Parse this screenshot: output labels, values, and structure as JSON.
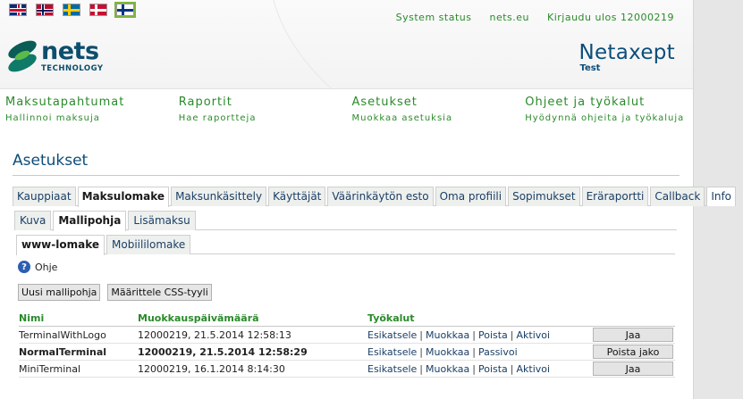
{
  "flags": [
    {
      "name": "uk-flag-icon",
      "cls": "flag-uk"
    },
    {
      "name": "norway-flag-icon",
      "cls": "flag-no"
    },
    {
      "name": "sweden-flag-icon",
      "cls": "flag-se"
    },
    {
      "name": "denmark-flag-icon",
      "cls": "flag-dk"
    },
    {
      "name": "finland-flag-icon",
      "cls": "flag-fi"
    }
  ],
  "top_links": {
    "system_status": "System status",
    "site": "nets.eu",
    "logout": "Kirjaudu ulos 12000219"
  },
  "logo": {
    "word": "nets",
    "sub": "TECHNOLOGY"
  },
  "product": {
    "name": "Netaxept",
    "env": "Test"
  },
  "main_nav": [
    {
      "title": "Maksutapahtumat",
      "sub": "Hallinnoi maksuja"
    },
    {
      "title": "Raportit",
      "sub": "Hae raportteja"
    },
    {
      "title": "Asetukset",
      "sub": "Muokkaa asetuksia"
    },
    {
      "title": "Ohjeet ja työkalut",
      "sub": "Hyödynnä ohjeita ja työkaluja"
    }
  ],
  "page_title": "Asetukset",
  "tabs_l1": [
    "Kauppiaat",
    "Maksulomake",
    "Maksunkäsittely",
    "Käyttäjät",
    "Väärinkäytön esto",
    "Oma profiili",
    "Sopimukset",
    "Eräraportti",
    "Callback",
    "Info"
  ],
  "tabs_l1_active": 1,
  "tabs_l2": [
    "Kuva",
    "Mallipohja",
    "Lisämaksu"
  ],
  "tabs_l2_active": 1,
  "tabs_l3": [
    "www-lomake",
    "Mobiililomake"
  ],
  "tabs_l3_active": 0,
  "help_label": "Ohje",
  "actions": {
    "new_template": "Uusi mallipohja",
    "define_css": "Määrittele CSS-tyyli"
  },
  "table": {
    "headers": {
      "name": "Nimi",
      "date": "Muokkauspäivämäärä",
      "tools": "Työkalut"
    },
    "rows": [
      {
        "name": "TerminalWithLogo",
        "date": "12000219, 21.5.2014 12:58:13",
        "tools": [
          "Esikatsele",
          "Muokkaa",
          "Poista",
          "Aktivoi"
        ],
        "button": "Jaa",
        "bold": false
      },
      {
        "name": "NormalTerminal",
        "date": "12000219, 21.5.2014 12:58:29",
        "tools": [
          "Esikatsele",
          "Muokkaa",
          "Passivoi"
        ],
        "button": "Poista jako",
        "bold": true
      },
      {
        "name": "MiniTerminal",
        "date": "12000219, 16.1.2014 8:14:30",
        "tools": [
          "Esikatsele",
          "Muokkaa",
          "Poista",
          "Aktivoi"
        ],
        "button": "Jaa",
        "bold": false
      }
    ]
  }
}
